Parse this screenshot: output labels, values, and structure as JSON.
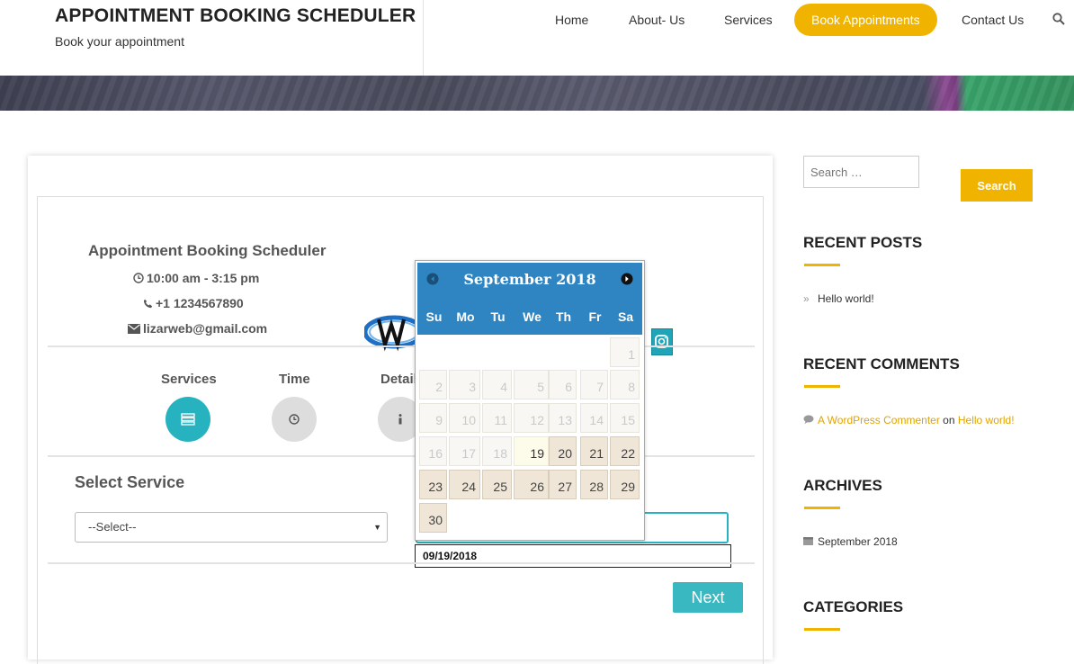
{
  "header": {
    "title": "APPOINTMENT BOOKING SCHEDULER",
    "tagline": "Book your appointment",
    "nav": [
      "Home",
      "About- Us",
      "Services",
      "Book Appointments",
      "Contact Us"
    ],
    "accent": "#f0b400"
  },
  "business": {
    "name": "Appointment Booking Scheduler",
    "hours": "10:00 am - 3:15 pm",
    "phone": "+1 1234567890",
    "email": "lizarweb@gmail.com"
  },
  "steps": [
    "Services",
    "Time",
    "Detail"
  ],
  "form": {
    "section_title": "Select Service",
    "select_value": "--Select--",
    "date_tooltip": "09/19/2018",
    "next_label": "Next"
  },
  "datepicker": {
    "title": "September 2018",
    "weekdays": [
      "Su",
      "Mo",
      "Tu",
      "We",
      "Th",
      "Fr",
      "Sa"
    ],
    "first_weekday_index": 6,
    "days_in_month": 30,
    "today": 19,
    "available_from": 20,
    "header_color": "#2e85c2"
  },
  "sidebar": {
    "search_placeholder": "Search …",
    "search_button": "Search",
    "recent_posts_heading": "RECENT POSTS",
    "recent_posts": [
      "Hello world!"
    ],
    "recent_comments_heading": "RECENT COMMENTS",
    "comment_author": "A WordPress Commenter",
    "comment_on": "on",
    "comment_post": "Hello world!",
    "archives_heading": "ARCHIVES",
    "archives": [
      "September 2018"
    ],
    "categories_heading": "CATEGORIES"
  }
}
